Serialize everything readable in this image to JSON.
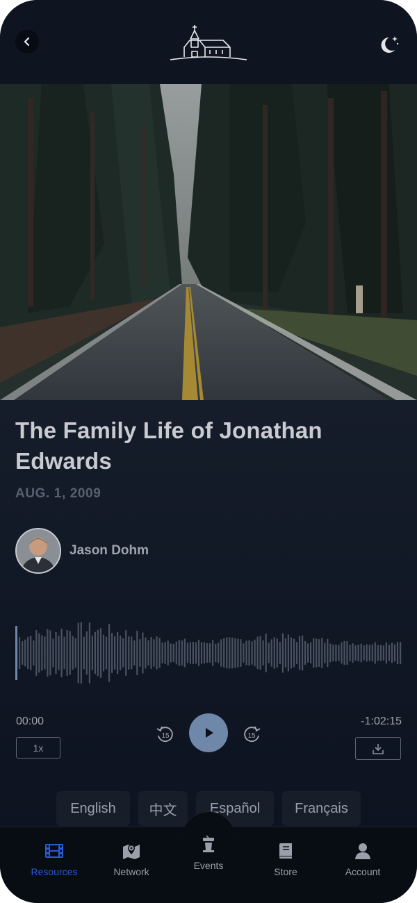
{
  "header": {
    "back_icon": "chevron-left-icon",
    "logo": "church-logo",
    "theme_icon": "moon-stars-icon"
  },
  "episode": {
    "title": "The Family Life of Jonathan Edwards",
    "date": "AUG. 1, 2009",
    "author": {
      "name": "Jason Dohm"
    }
  },
  "player": {
    "elapsed": "00:00",
    "remaining": "-1:02:15",
    "speed": "1x",
    "progress": 0.0,
    "skip_back_label": "15",
    "skip_forward_label": "15",
    "accent_color": "#6f87a8"
  },
  "languages": [
    "English",
    "中文",
    "Español",
    "Français"
  ],
  "tabs": [
    {
      "label": "Resources",
      "icon": "film-icon",
      "active": true
    },
    {
      "label": "Network",
      "icon": "map-pin-icon",
      "active": false
    },
    {
      "label": "Events",
      "icon": "podium-icon",
      "active": false
    },
    {
      "label": "Store",
      "icon": "book-icon",
      "active": false
    },
    {
      "label": "Account",
      "icon": "user-icon",
      "active": false
    }
  ],
  "colors": {
    "active_tab": "#2a5bd6",
    "background": "#0d131e"
  }
}
